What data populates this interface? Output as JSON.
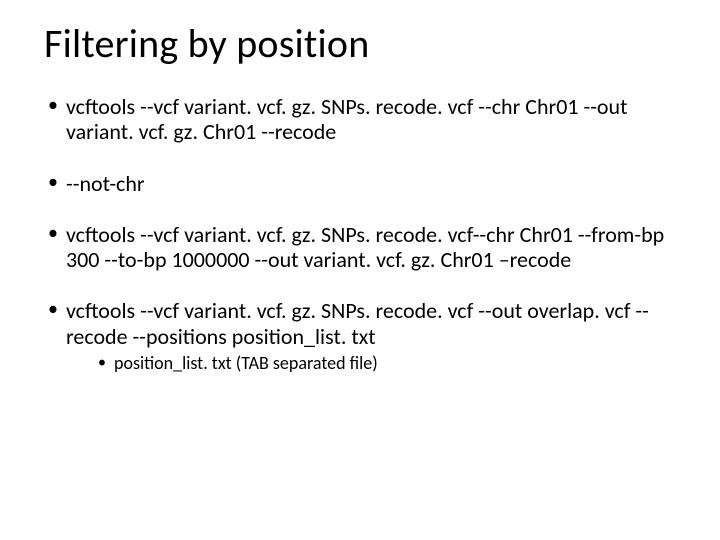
{
  "title": "Filtering by position",
  "bullets": [
    {
      "text": "vcftools --vcf variant. vcf. gz. SNPs. recode. vcf --chr Chr01 --out variant. vcf. gz. Chr01 --recode"
    },
    {
      "text": "--not-chr"
    },
    {
      "text": "vcftools --vcf variant. vcf. gz. SNPs. recode. vcf--chr Chr01 --from-bp 300 --to-bp 1000000 --out variant. vcf. gz. Chr01 –recode"
    },
    {
      "text": "vcftools --vcf variant. vcf. gz. SNPs. recode. vcf --out overlap. vcf --recode --positions position_list. txt",
      "sub": [
        {
          "text": "position_list. txt (TAB separated file)"
        }
      ]
    }
  ]
}
